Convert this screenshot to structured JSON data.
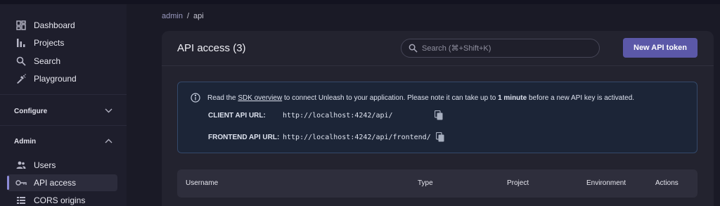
{
  "sidebar": {
    "items": [
      {
        "label": "Dashboard",
        "icon": "dashboard-icon"
      },
      {
        "label": "Projects",
        "icon": "projects-icon"
      },
      {
        "label": "Search",
        "icon": "search-icon"
      },
      {
        "label": "Playground",
        "icon": "playground-icon"
      }
    ],
    "configure": {
      "label": "Configure",
      "state": "collapsed"
    },
    "admin": {
      "label": "Admin",
      "state": "expanded",
      "items": [
        {
          "label": "Users",
          "icon": "users-icon"
        },
        {
          "label": "API access",
          "icon": "key-icon",
          "active": true
        },
        {
          "label": "CORS origins",
          "icon": "cors-list-icon"
        }
      ]
    }
  },
  "breadcrumb": {
    "parent": "admin",
    "separator": "/",
    "current": "api"
  },
  "header": {
    "title": "API access (3)",
    "search_placeholder": "Search (⌘+Shift+K)",
    "new_token_label": "New API token"
  },
  "info": {
    "text_before": "Read the ",
    "link_text": "SDK overview",
    "text_middle": " to connect Unleash to your application. Please note it can take up to ",
    "bold_text": "1 minute",
    "text_after": " before a new API key is activated.",
    "client_label": "CLIENT API URL:",
    "client_url": "http://localhost:4242/api/",
    "frontend_label": "FRONTEND API URL:",
    "frontend_url": "http://localhost:4242/api/frontend/"
  },
  "table": {
    "columns": [
      "Username",
      "Type",
      "Project",
      "Environment",
      "Actions"
    ]
  },
  "colors": {
    "accent": "#5b58a8",
    "active_indicator": "#8d8bd9",
    "info_background": "#1c2537",
    "info_border": "#34496a"
  }
}
